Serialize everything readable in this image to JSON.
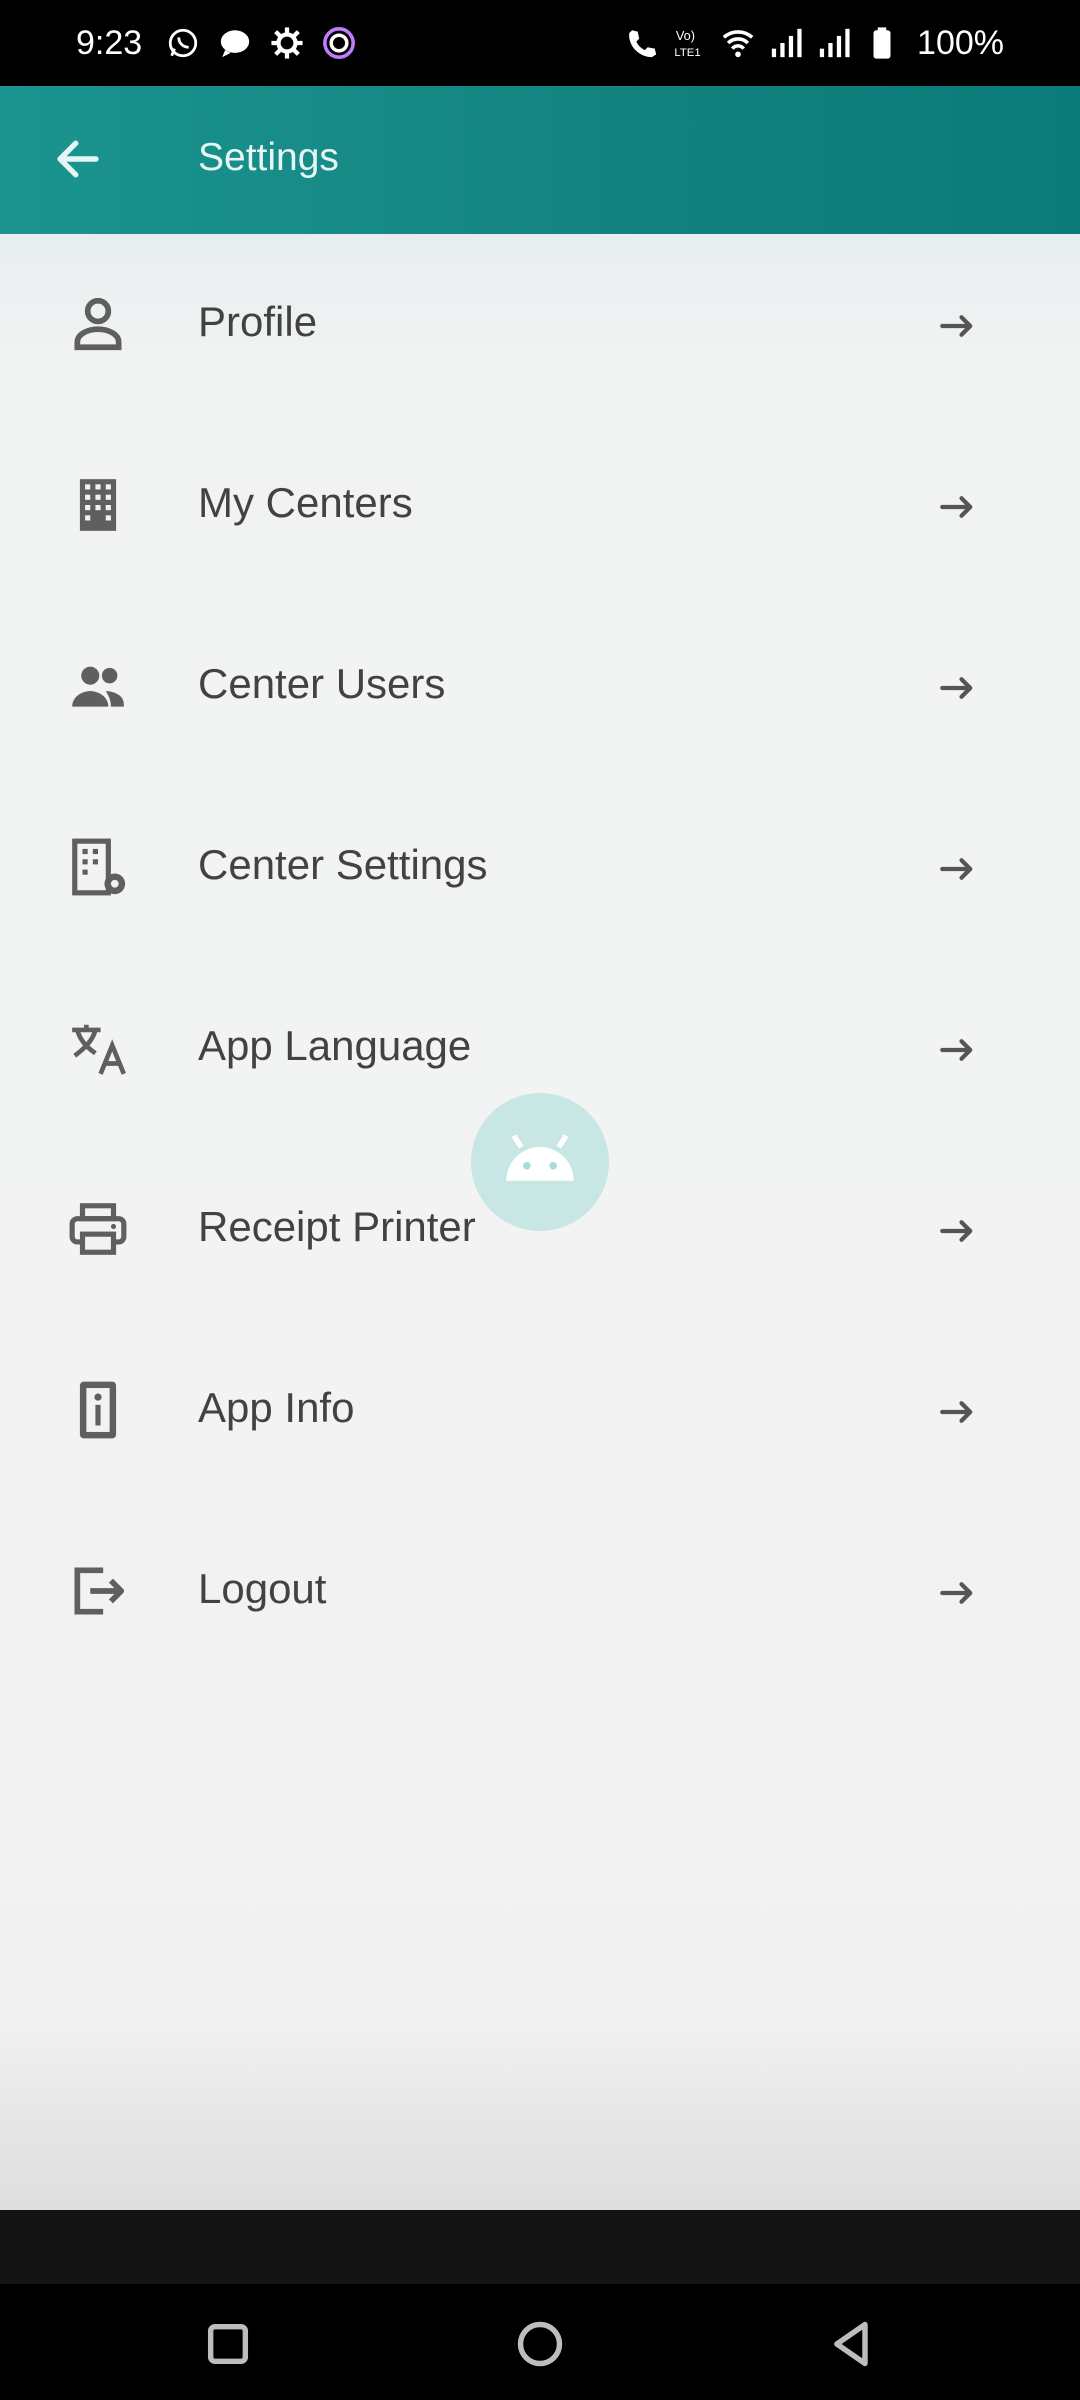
{
  "status_bar": {
    "time": "9:23",
    "battery": "100%",
    "left_icons": [
      "whatsapp-icon",
      "message-icon",
      "gear-icon",
      "app-notification-icon"
    ],
    "right_icons": [
      "call-icon",
      "volte-icon",
      "wifi-icon",
      "signal-1-icon",
      "signal-2-icon",
      "battery-icon"
    ]
  },
  "app_bar": {
    "title": "Settings",
    "back_icon": "arrow-left-icon",
    "background_color": "#13827f"
  },
  "settings": {
    "items": [
      {
        "label": "Profile",
        "icon": "person-icon"
      },
      {
        "label": "My Centers",
        "icon": "building-icon"
      },
      {
        "label": "Center Users",
        "icon": "people-icon"
      },
      {
        "label": "Center Settings",
        "icon": "building-gear-icon"
      },
      {
        "label": "App Language",
        "icon": "translate-icon"
      },
      {
        "label": "Receipt Printer",
        "icon": "printer-icon"
      },
      {
        "label": "App Info",
        "icon": "info-icon"
      },
      {
        "label": "Logout",
        "icon": "logout-icon"
      }
    ],
    "arrow_icon": "arrow-right-icon"
  },
  "overlay": {
    "icon": "android-icon"
  },
  "nav_bar": {
    "buttons": [
      "recent-apps-icon",
      "home-icon",
      "back-triangle-icon"
    ]
  }
}
